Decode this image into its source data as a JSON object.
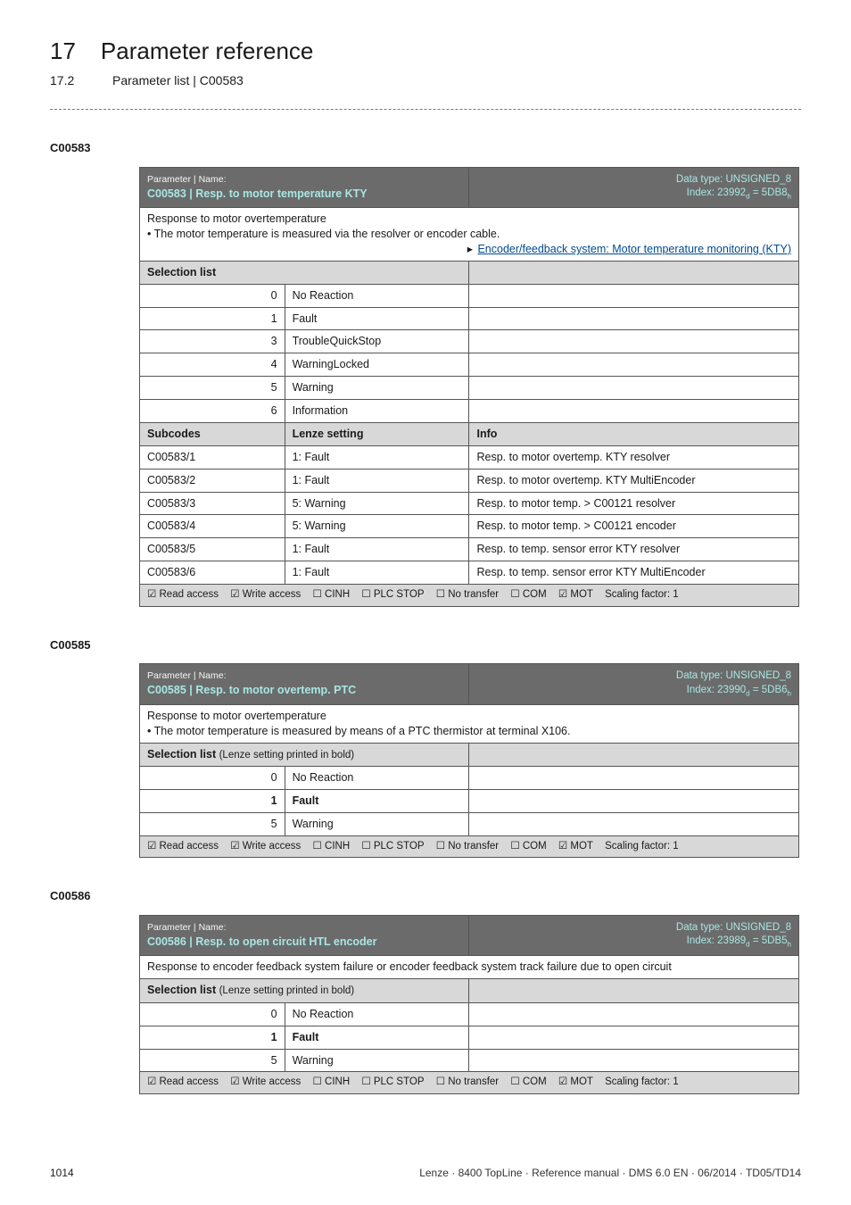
{
  "header": {
    "num": "17",
    "title": "Parameter reference",
    "sub_num": "17.2",
    "sub_title": "Parameter list | C00583"
  },
  "p583": {
    "id_label": "C00583",
    "title_top": "Parameter | Name:",
    "title_name": "C00583 | Resp. to motor temperature KTY",
    "type_line1": "Data type: UNSIGNED_8",
    "type_line2_html": "Index: 23992<sub>d</sub> = 5DB8<sub>h</sub>",
    "desc1": "Response to motor overtemperature",
    "desc2": "• The motor temperature is measured via the resolver or encoder cable.",
    "link_text": "Encoder/feedback system: Motor temperature monitoring (KTY)",
    "selection_header": "Selection list",
    "list": [
      {
        "n": "0",
        "t": "No Reaction"
      },
      {
        "n": "1",
        "t": "Fault"
      },
      {
        "n": "3",
        "t": "TroubleQuickStop"
      },
      {
        "n": "4",
        "t": "WarningLocked"
      },
      {
        "n": "5",
        "t": "Warning"
      },
      {
        "n": "6",
        "t": "Information"
      }
    ],
    "subcodes_header_l": "Subcodes",
    "subcodes_header_m": "Lenze setting",
    "subcodes_header_r": "Info",
    "subcodes": [
      {
        "c": "C00583/1",
        "s": "1: Fault",
        "i": "Resp. to motor overtemp. KTY resolver"
      },
      {
        "c": "C00583/2",
        "s": "1: Fault",
        "i": "Resp. to motor overtemp. KTY MultiEncoder"
      },
      {
        "c": "C00583/3",
        "s": "5: Warning",
        "i": "Resp. to motor temp. > C00121 resolver"
      },
      {
        "c": "C00583/4",
        "s": "5: Warning",
        "i": "Resp. to motor temp. > C00121 encoder"
      },
      {
        "c": "C00583/5",
        "s": "1: Fault",
        "i": "Resp. to temp. sensor error KTY resolver"
      },
      {
        "c": "C00583/6",
        "s": "1: Fault",
        "i": "Resp. to temp. sensor error KTY MultiEncoder"
      }
    ],
    "foot": {
      "read": "☑ Read access",
      "write": "☑ Write access",
      "cinh": "☐ CINH",
      "plc": "☐ PLC STOP",
      "noxfer": "☐ No transfer",
      "com": "☐ COM",
      "mot": "☑ MOT",
      "scale": "Scaling factor: 1"
    }
  },
  "p585": {
    "id_label": "C00585",
    "title_top": "Parameter | Name:",
    "title_name": "C00585 | Resp. to motor overtemp. PTC",
    "type_line1": "Data type: UNSIGNED_8",
    "type_line2_html": "Index: 23990<sub>d</sub> = 5DB6<sub>h</sub>",
    "desc1": "Response to motor overtemperature",
    "desc2": "• The motor temperature is measured by means of a PTC thermistor at terminal X106.",
    "selection_header": "Selection list",
    "selection_sub": "(Lenze setting printed in bold)",
    "list": [
      {
        "n": "0",
        "t": "No Reaction",
        "bold": false
      },
      {
        "n": "1",
        "t": "Fault",
        "bold": true
      },
      {
        "n": "5",
        "t": "Warning",
        "bold": false
      }
    ],
    "foot": {
      "read": "☑ Read access",
      "write": "☑ Write access",
      "cinh": "☐ CINH",
      "plc": "☐ PLC STOP",
      "noxfer": "☐ No transfer",
      "com": "☐ COM",
      "mot": "☑ MOT",
      "scale": "Scaling factor: 1"
    }
  },
  "p586": {
    "id_label": "C00586",
    "title_top": "Parameter | Name:",
    "title_name": "C00586 | Resp. to open circuit HTL encoder",
    "type_line1": "Data type: UNSIGNED_8",
    "type_line2_html": "Index: 23989<sub>d</sub> = 5DB5<sub>h</sub>",
    "desc1": "Response to encoder feedback system failure or encoder feedback system track failure due to open circuit",
    "selection_header": "Selection list",
    "selection_sub": "(Lenze setting printed in bold)",
    "list": [
      {
        "n": "0",
        "t": "No Reaction",
        "bold": false
      },
      {
        "n": "1",
        "t": "Fault",
        "bold": true
      },
      {
        "n": "5",
        "t": "Warning",
        "bold": false
      }
    ],
    "foot": {
      "read": "☑ Read access",
      "write": "☑ Write access",
      "cinh": "☐ CINH",
      "plc": "☐ PLC STOP",
      "noxfer": "☐ No transfer",
      "com": "☐ COM",
      "mot": "☑ MOT",
      "scale": "Scaling factor: 1"
    }
  },
  "footer": {
    "page": "1014",
    "meta": "Lenze · 8400 TopLine · Reference manual · DMS 6.0 EN · 06/2014 · TD05/TD14"
  }
}
